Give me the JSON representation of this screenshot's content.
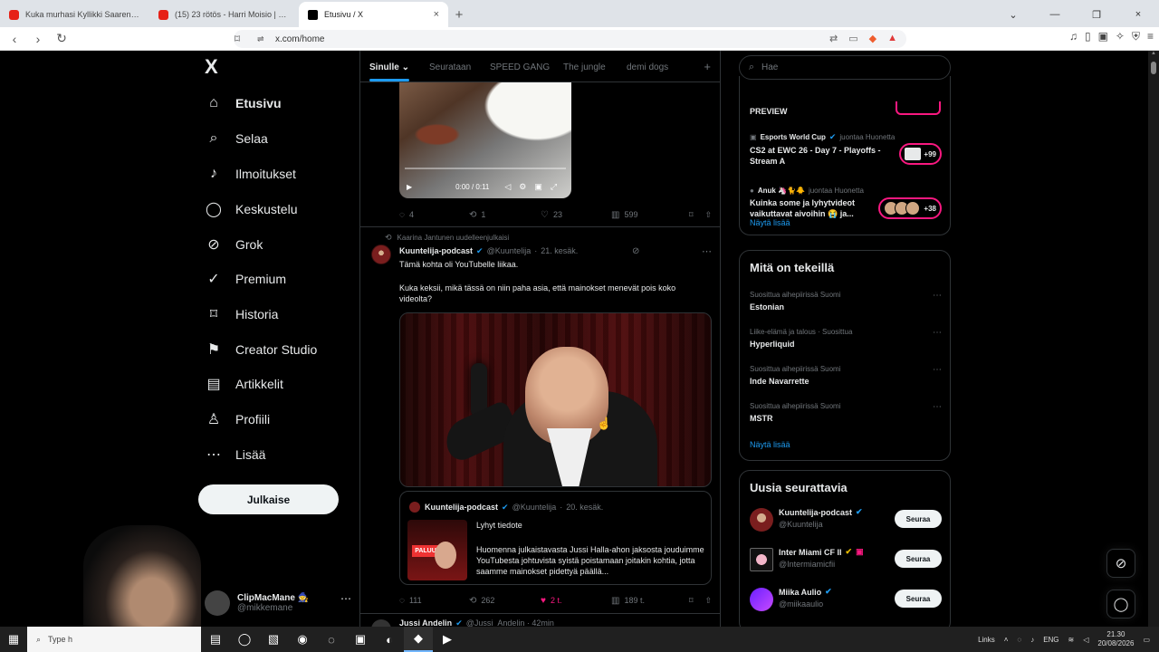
{
  "browser": {
    "tabs": [
      {
        "title": "Kuka murhasi Kyllikki Saaren? | 23 rö...",
        "favicon": "youtube-icon",
        "active": false
      },
      {
        "title": "(15) 23 rötös - Harri Moisio | 24 - Yo...",
        "favicon": "youtube-icon",
        "active": false
      },
      {
        "title": "Etusivu / X",
        "favicon": "x-icon",
        "active": true
      }
    ],
    "new_tab_label": "+",
    "address": "x.com/home",
    "accent": "#ef5d2e"
  },
  "sidebar": {
    "logo": "X",
    "items": [
      {
        "label": "Etusivu",
        "icon": "home-icon",
        "active": true
      },
      {
        "label": "Selaa",
        "icon": "search-icon",
        "active": false
      },
      {
        "label": "Ilmoitukset",
        "icon": "bell-icon",
        "active": false
      },
      {
        "label": "Keskustelu",
        "icon": "chat-icon",
        "active": false
      },
      {
        "label": "Grok",
        "icon": "grok-icon",
        "active": false
      },
      {
        "label": "Premium",
        "icon": "premium-icon",
        "active": false
      },
      {
        "label": "Historia",
        "icon": "bookmark-icon",
        "active": false
      },
      {
        "label": "Creator Studio",
        "icon": "rocket-icon",
        "active": false
      },
      {
        "label": "Artikkelit",
        "icon": "article-icon",
        "active": false
      },
      {
        "label": "Profiili",
        "icon": "person-icon",
        "active": false
      },
      {
        "label": "Lisää",
        "icon": "more-icon",
        "active": false
      }
    ],
    "post_label": "Julkaise",
    "account": {
      "name": "ClipMacMane 🧙",
      "handle": "@mikkemane"
    }
  },
  "feed": {
    "tabs": [
      "Sinulle",
      "Seurataan",
      "SPEED GANG",
      "The jungle",
      "demi dogs"
    ],
    "tab_dropdown_icon": "⌄",
    "tab_plus": "+",
    "top_video": {
      "time": "0:00 / 0:11"
    },
    "top_actions": {
      "replies": "4",
      "reposts": "1",
      "likes": "23",
      "views": "599"
    },
    "repost_by": "Kaarina Jantunen uudelleenjulkaisi",
    "tweet": {
      "author": "Kuuntelija-podcast",
      "handle": "@Kuuntelija",
      "date": "21. kesäk.",
      "text_1": "Tämä kohta oli YouTubelle liikaa.",
      "text_2": "Kuka keksii, mikä tässä on niin paha asia, että mainokset menevät pois koko videolta?"
    },
    "quote": {
      "author": "Kuuntelija-podcast",
      "handle": "@Kuuntelija",
      "date": "20. kesäk.",
      "title": "Lyhyt tiedote",
      "thumb_label": "PALUU",
      "body": "Huomenna julkaistavasta Jussi Halla-ahon jaksosta jouduimme YouTubesta johtuvista syistä poistamaan joitakin kohtia, jotta saamme mainokset pidettyä päällä..."
    },
    "actions": {
      "replies": "111",
      "reposts": "262",
      "likes": "2 t.",
      "views": "189 t."
    },
    "next_author": "Jussi Andelin",
    "next_meta": "@Jussi_Andelin · 42min"
  },
  "search": {
    "placeholder": "Hae"
  },
  "live": {
    "preview": "PREVIEW",
    "items": [
      {
        "name": "Esports World Cup",
        "action": "juontaa Huonetta",
        "title": "CS2 at EWC 26 - Day 7 - Playoffs - Stream A",
        "count": "+99"
      },
      {
        "name": "Anuk 🦄🐈🐥",
        "action": "juontaa Huonetta",
        "title": "Kuinka some ja lyhytvideot vaikuttavat aivoihin 😭 ja...",
        "count": "+38"
      }
    ],
    "show_more": "Näytä lisää"
  },
  "trends": {
    "title": "Mitä on tekeillä",
    "items": [
      {
        "meta": "Suosittua aihepiirissä Suomi",
        "name": "Estonian"
      },
      {
        "meta": "Liike-elämä ja talous · Suosittua",
        "name": "Hyperliquid"
      },
      {
        "meta": "Suosittua aihepiirissä Suomi",
        "name": "Inde Navarrette"
      },
      {
        "meta": "Suosittua aihepiirissä Suomi",
        "name": "MSTR"
      }
    ],
    "show_more": "Näytä lisää"
  },
  "follows": {
    "title": "Uusia seurattavia",
    "items": [
      {
        "name": "Kuuntelija-podcast",
        "handle": "@Kuuntelija",
        "button": "Seuraa"
      },
      {
        "name": "Inter Miami CF II",
        "handle": "@Intermiamicfii",
        "button": "Seuraa"
      },
      {
        "name": "Miika Aulio",
        "handle": "@miikaaulio",
        "button": "Seuraa"
      }
    ]
  },
  "taskbar": {
    "search_placeholder": "Type h",
    "links": "Links",
    "language": "ENG",
    "time": "21.30",
    "date": "20/08/2026"
  }
}
